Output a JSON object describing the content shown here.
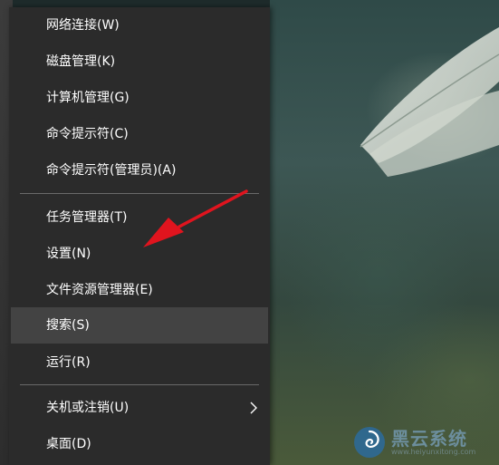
{
  "menu": {
    "items": [
      {
        "label": "网络连接(W)"
      },
      {
        "label": "磁盘管理(K)"
      },
      {
        "label": "计算机管理(G)"
      },
      {
        "label": "命令提示符(C)"
      },
      {
        "label": "命令提示符(管理员)(A)"
      },
      {
        "label": "任务管理器(T)"
      },
      {
        "label": "设置(N)"
      },
      {
        "label": "文件资源管理器(E)"
      },
      {
        "label": "搜索(S)",
        "highlighted": true
      },
      {
        "label": "运行(R)"
      },
      {
        "label": "关机或注销(U)",
        "submenu": true
      },
      {
        "label": "桌面(D)"
      }
    ]
  },
  "annotation": {
    "color": "#e0141e"
  },
  "watermark": {
    "text": "黑云系统",
    "subtext": "www.heiyunxitong.com"
  },
  "colors": {
    "menu_bg": "#2b2b2b",
    "highlight": "#434343",
    "text": "#ffffff",
    "separator": "#6a6a6a"
  }
}
